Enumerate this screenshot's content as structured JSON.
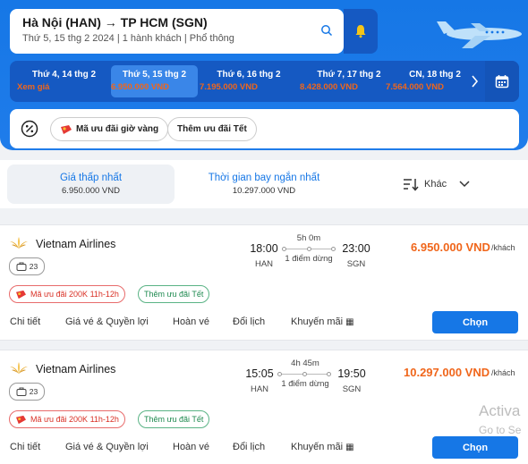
{
  "search": {
    "route": "Hà Nội (HAN) → TP HCM (SGN)",
    "details": "Thứ 5, 15 thg 2 2024 | 1 hành khách | Phổ thông"
  },
  "date_tabs": [
    {
      "label": "Thứ 4, 14 thg 2",
      "price": "Xem giá",
      "active": false
    },
    {
      "label": "Thứ 5, 15 thg 2",
      "price": "6.950.000 VND",
      "active": true
    },
    {
      "label": "Thứ 6, 16 thg 2",
      "price": "7.195.000 VND",
      "active": false
    },
    {
      "label": "Thứ 7, 17 thg 2",
      "price": "8.428.000 VND",
      "active": false
    },
    {
      "label": "CN, 18 thg 2",
      "price": "7.564.000 VND",
      "active": false
    }
  ],
  "promos": {
    "golden_hour": "Mã ưu đãi giờ vàng",
    "tet": "Thêm ưu đãi Tết"
  },
  "sort": {
    "cheapest_label": "Giá thấp nhất",
    "cheapest_value": "6.950.000 VND",
    "fastest_label": "Thời gian bay ngắn nhất",
    "fastest_value": "10.297.000 VND",
    "more_label": "Khác"
  },
  "flights": [
    {
      "airline": "Vietnam Airlines",
      "bag_count": "23",
      "depart_time": "18:00",
      "depart_code": "HAN",
      "arrive_time": "23:00",
      "arrive_code": "SGN",
      "duration": "5h 0m",
      "stops": "1 điểm dừng",
      "price": "6.950.000 VND",
      "per": "/khách",
      "promo_red": "Mã ưu đãi 200K 11h-12h",
      "promo_green": "Thêm ưu đãi Tết"
    },
    {
      "airline": "Vietnam Airlines",
      "bag_count": "23",
      "depart_time": "15:05",
      "depart_code": "HAN",
      "arrive_time": "19:50",
      "arrive_code": "SGN",
      "duration": "4h 45m",
      "stops": "1 điểm dừng",
      "price": "10.297.000 VND",
      "per": "/khách",
      "promo_red": "Mã ưu đãi 200K 11h-12h",
      "promo_green": "Thêm ưu đãi Tết"
    }
  ],
  "card_tabs": [
    "Chi tiết",
    "Giá vé & Quyền lợi",
    "Hoàn vé",
    "Đổi lịch",
    "Khuyến mãi"
  ],
  "choose_label": "Chọn",
  "watermark": {
    "line1": "Activa",
    "line2": "Go to Se"
  },
  "colors": {
    "primary": "#1677e6",
    "price": "#f0661b",
    "dark_blue": "#1559c2"
  }
}
